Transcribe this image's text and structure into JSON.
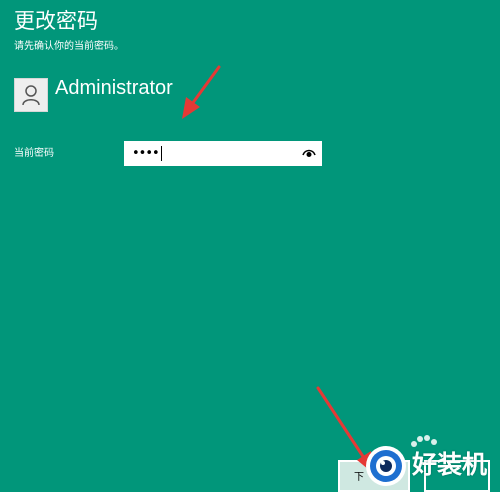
{
  "dialog": {
    "title": "更改密码",
    "subtitle": "请先确认你的当前密码。"
  },
  "user": {
    "name": "Administrator",
    "avatar_icon": "user-icon"
  },
  "password_field": {
    "label": "当前密码",
    "value": "••••",
    "reveal_icon": "eye-icon"
  },
  "buttons": {
    "next_label": "下"
  },
  "watermark": {
    "text": "好装机"
  },
  "colors": {
    "background": "#01967a",
    "text": "#ffffff",
    "annotation_arrow": "#e53935"
  }
}
